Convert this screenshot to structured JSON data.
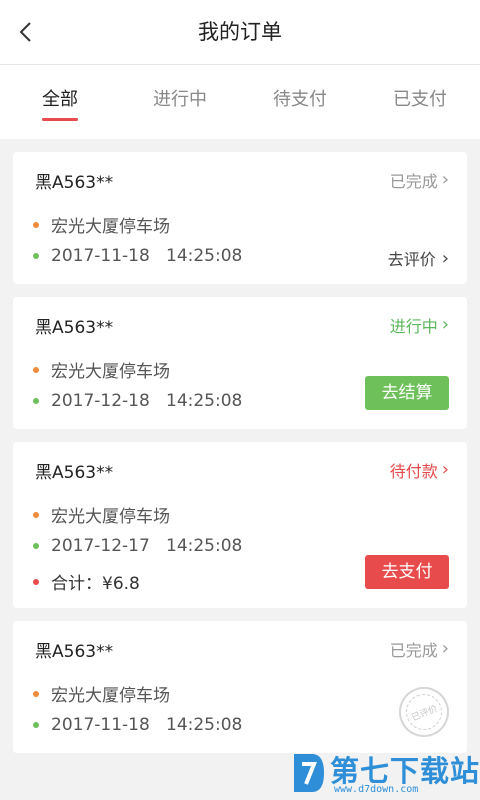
{
  "header": {
    "title": "我的订单",
    "back_icon": "chevron-left-icon"
  },
  "tabs": [
    {
      "label": "全部",
      "active": true
    },
    {
      "label": "进行中",
      "active": false
    },
    {
      "label": "待支付",
      "active": false
    },
    {
      "label": "已支付",
      "active": false
    }
  ],
  "colors": {
    "accent_red": "#e84b4b",
    "green": "#6dc05a",
    "orange_dot": "#f08a3c",
    "watermark_blue": "#2e8fd8"
  },
  "orders": [
    {
      "plate": "黑A563**",
      "status": "已完成",
      "status_color": "#999999",
      "location": "宏光大厦停车场",
      "time": "2017-11-18   14:25:08",
      "action": {
        "type": "link",
        "label": "去评价"
      }
    },
    {
      "plate": "黑A563**",
      "status": "进行中",
      "status_color": "#5cb85c",
      "location": "宏光大厦停车场",
      "time": "2017-12-18   14:25:08",
      "action": {
        "type": "button",
        "label": "去结算",
        "color": "#6dc05a"
      }
    },
    {
      "plate": "黑A563**",
      "status": "待付款",
      "status_color": "#e84b4b",
      "location": "宏光大厦停车场",
      "time": "2017-12-17   14:25:08",
      "total": "合计：¥6.8",
      "action": {
        "type": "button",
        "label": "去支付",
        "color": "#e84b4b"
      }
    },
    {
      "plate": "黑A563**",
      "status": "已完成",
      "status_color": "#999999",
      "location": "宏光大厦停车场",
      "time": "2017-11-18   14:25:08",
      "action": {
        "type": "stamp",
        "label": "已评价"
      }
    }
  ],
  "watermark": {
    "brand": "第七下载站",
    "url": "www.d7down.com"
  }
}
